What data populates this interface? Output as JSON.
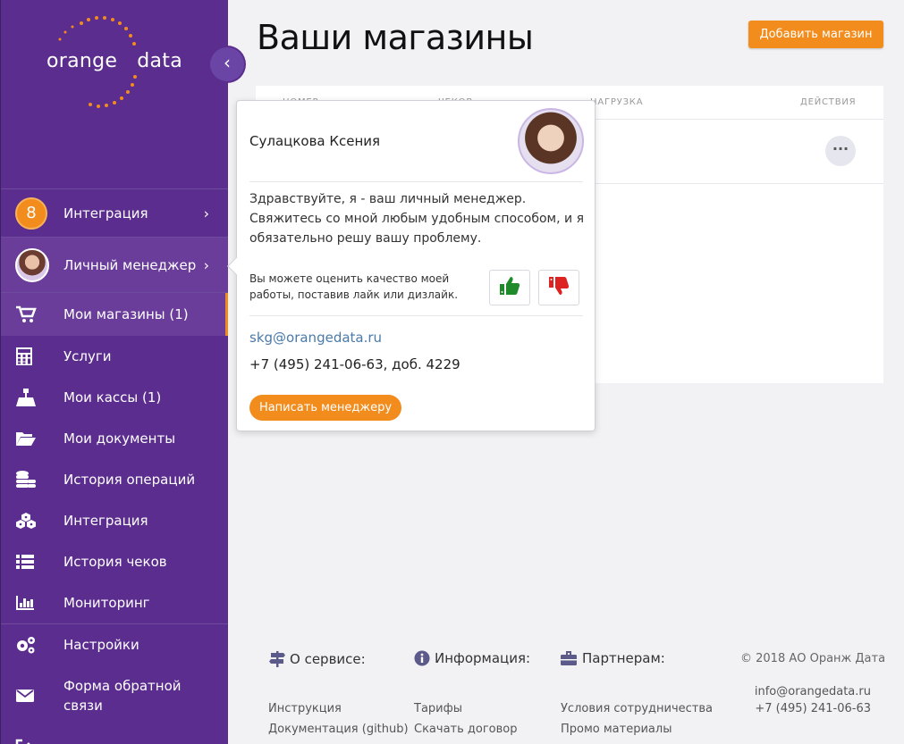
{
  "logo": {
    "part1": "orange",
    "part2": "data"
  },
  "sidebar": {
    "integration_badge": "8",
    "items": [
      {
        "label": "Интеграция",
        "icon": "integration-badge"
      },
      {
        "label": "Личный менеджер",
        "icon": "manager-avatar"
      },
      {
        "label": "Мои магазины (1)",
        "icon": "cart-icon"
      },
      {
        "label": "Услуги",
        "icon": "calculator-icon"
      },
      {
        "label": "Мои кассы (1)",
        "icon": "cash-register-icon"
      },
      {
        "label": "Мои документы",
        "icon": "folder-icon"
      },
      {
        "label": "История операций",
        "icon": "database-icon"
      },
      {
        "label": "Интеграция",
        "icon": "cubes-icon"
      },
      {
        "label": "История чеков",
        "icon": "list-icon"
      },
      {
        "label": "Мониторинг",
        "icon": "bar-chart-icon"
      },
      {
        "label": "Настройки",
        "icon": "gears-icon"
      },
      {
        "label": "Форма обратной связи",
        "icon": "envelope-icon"
      }
    ]
  },
  "main": {
    "title": "Ваши магазины",
    "add_button": "Добавить магазин",
    "table": {
      "headers": [
        "НОМЕР",
        "ЧЕКОВ",
        "НАГРУЗКА",
        "ДЕЙСТВИЯ"
      ],
      "actions_label": "···"
    }
  },
  "popover": {
    "name": "Сулацкова Ксения",
    "greeting": "Здравствуйте, я - ваш личный менеджер. Свяжитесь со мной любым удобным способом, и я обязательно решу вашу проблему.",
    "rate_text": "Вы можете оценить качество моей работы, поставив лайк или дизлайк.",
    "email": "skg@orangedata.ru",
    "phone": "+7 (495) 241-06-63, доб. 4229",
    "write_button": "Написать менеджеру"
  },
  "footer": {
    "about": {
      "title": "О сервисе:",
      "links": [
        "Инструкция",
        "Документация (github)"
      ]
    },
    "info": {
      "title": "Информация:",
      "links": [
        "Тарифы",
        "Скачать договор"
      ]
    },
    "partners": {
      "title": "Партнерам:",
      "links": [
        "Условия сотрудничества",
        "Промо материалы"
      ]
    },
    "copyright": "© 2018 АО Оранж Дата",
    "email": "info@orangedata.ru",
    "phone": "+7 (495) 241-06-63"
  },
  "colors": {
    "sidebar": "#5b2d8e",
    "accent": "#f28c1d",
    "link": "#4a7aa8"
  }
}
